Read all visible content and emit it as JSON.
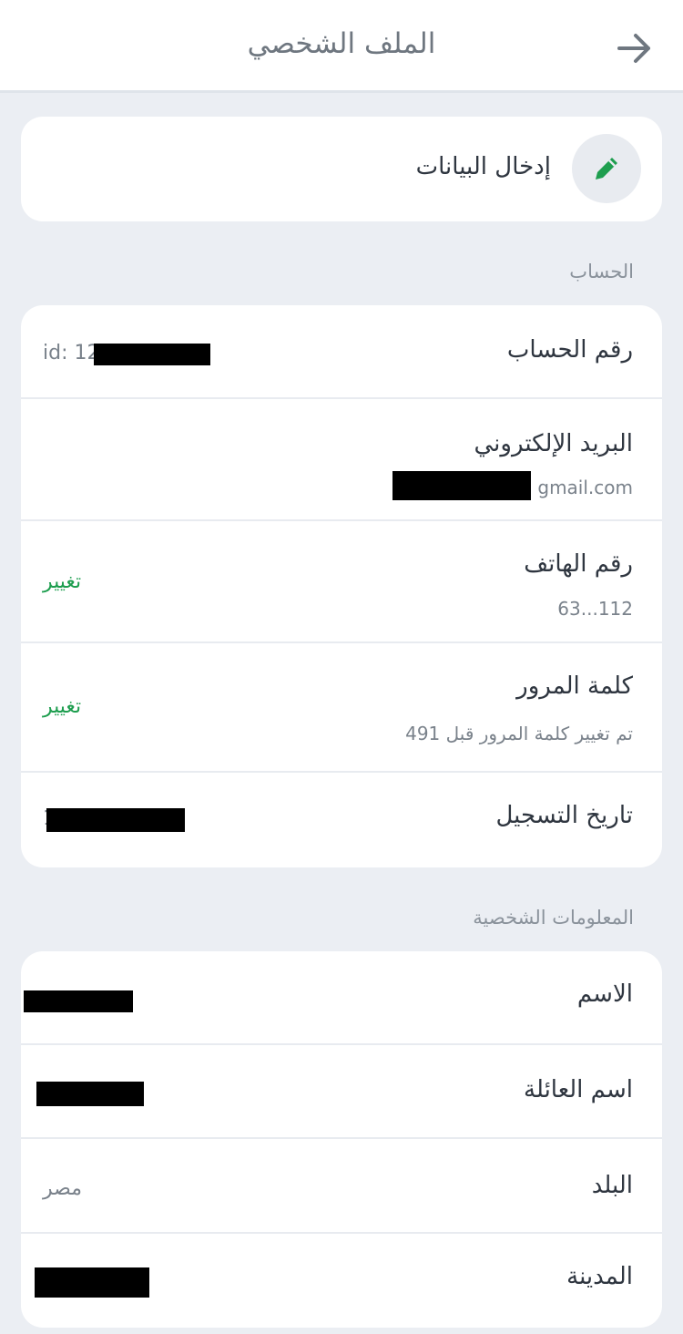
{
  "header": {
    "title": "الملف الشخصي",
    "back_icon": "arrow-right-icon"
  },
  "edit_data": {
    "label": "إدخال البيانات",
    "icon": "pencil-icon",
    "accent_color": "#1e9e4f"
  },
  "account_section": {
    "title": "الحساب",
    "rows": {
      "account_number": {
        "label": "رقم الحساب",
        "value": "id: 12"
      },
      "email": {
        "label": "البريد الإلكتروني",
        "value": "gmail.com"
      },
      "phone": {
        "label": "رقم الهاتف",
        "value": "63...112",
        "action": "تغيير"
      },
      "password": {
        "label": "كلمة المرور",
        "sub": "تم تغيير كلمة المرور قبل 491",
        "action": "تغيير"
      },
      "registration_date": {
        "label": "تاريخ التسجيل",
        "value": "1"
      }
    }
  },
  "personal_section": {
    "title": "المعلومات الشخصية",
    "rows": {
      "first_name": {
        "label": "الاسم"
      },
      "last_name": {
        "label": "اسم العائلة"
      },
      "country": {
        "label": "البلد",
        "value": "مصر"
      },
      "city": {
        "label": "المدينة"
      }
    }
  }
}
